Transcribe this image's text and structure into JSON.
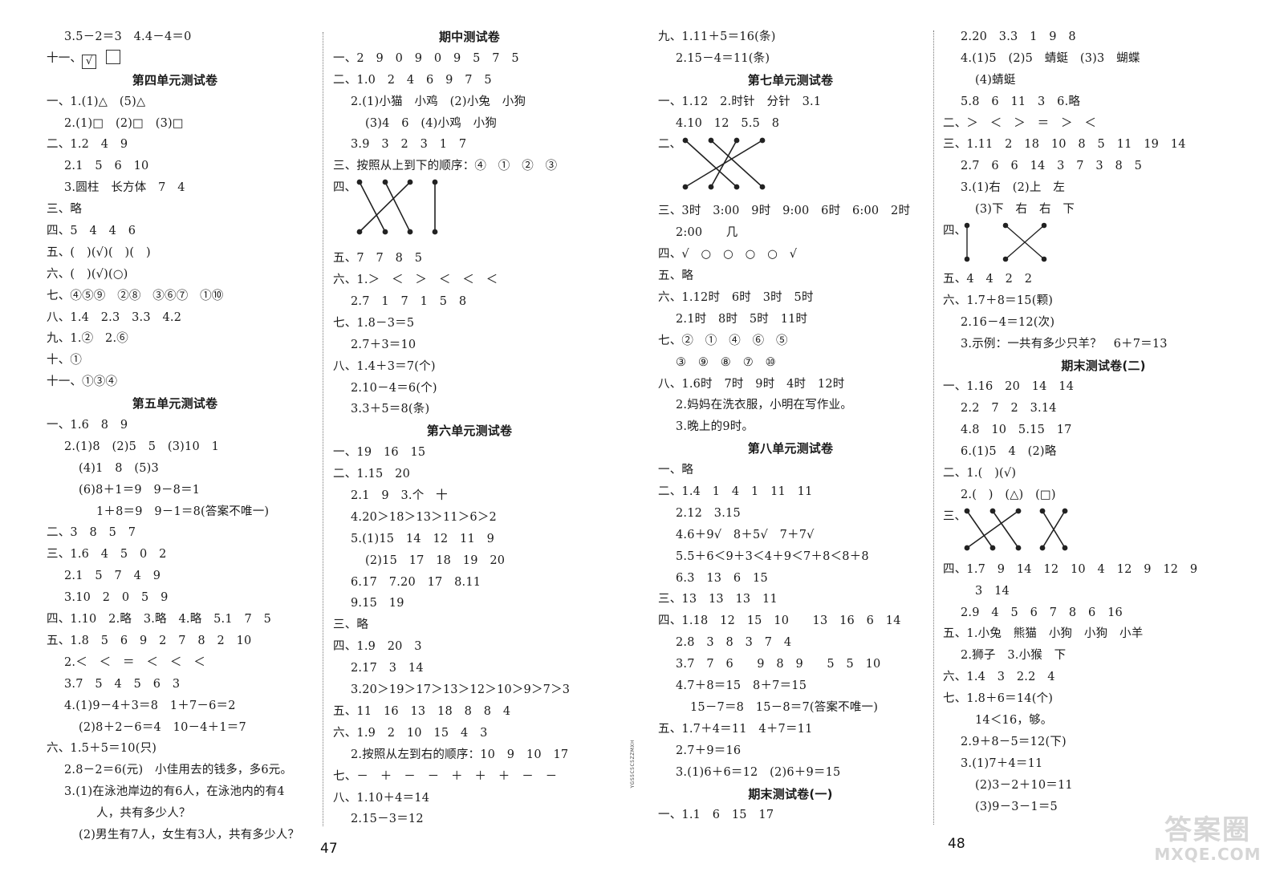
{
  "pages": {
    "left_number": "47",
    "right_number": "48"
  },
  "side_code": "YGS5C5C5ZZMXH",
  "watermark": {
    "line1": "答案圈",
    "line2": "MXQE.COM"
  },
  "col1": {
    "top_line": "3.5－2＝3　4.4－4＝0",
    "eleven_label": "十一、",
    "eleven_box1": "√",
    "eleven_box2": "",
    "unit4_title": "第四单元测试卷",
    "unit4_lines": [
      {
        "t": "一、1.(1)△　(5)△",
        "i": 0
      },
      {
        "t": "2.(1)□　(2)□　(3)□",
        "i": 1
      },
      {
        "t": "二、1.2　4　9",
        "i": 0
      },
      {
        "t": "2.1　5　6　10",
        "i": 1
      },
      {
        "t": "3.圆柱　长方体　7　4",
        "i": 1
      },
      {
        "t": "三、略",
        "i": 0
      },
      {
        "t": "四、5　4　4　6",
        "i": 0
      },
      {
        "t": "五、(　)(√)(　)(　)",
        "i": 0
      },
      {
        "t": "六、(　)(√)(○)",
        "i": 0
      },
      {
        "t": "七、④⑤⑨　②⑧　③⑥⑦　①⑩",
        "i": 0
      },
      {
        "t": "八、1.4　2.3　3.3　4.2",
        "i": 0
      },
      {
        "t": "九、1.②　2.⑥",
        "i": 0
      },
      {
        "t": "十、①",
        "i": 0
      },
      {
        "t": "十一、①③④",
        "i": 0
      }
    ],
    "unit5_title": "第五单元测试卷",
    "unit5_lines": [
      {
        "t": "一、1.6　8　9",
        "i": 0
      },
      {
        "t": "2.(1)8　(2)5　5　(3)10　1",
        "i": 1
      },
      {
        "t": "(4)1　8　(5)3",
        "i": 2
      },
      {
        "t": "(6)8＋1＝9　9－8＝1",
        "i": 2
      },
      {
        "t": "1＋8＝9　9－1＝8(答案不唯一)",
        "i": 3
      },
      {
        "t": "二、3　8　5　7",
        "i": 0
      },
      {
        "t": "三、1.6　4　5　0　2",
        "i": 0
      },
      {
        "t": "2.1　5　7　4　9",
        "i": 1
      },
      {
        "t": "3.10　2　0　5　9",
        "i": 1
      },
      {
        "t": "四、1.10　2.略　3.略　4.略　5.1　7　5",
        "i": 0
      },
      {
        "t": "五、1.8　5　6　9　2　7　8　2　10",
        "i": 0
      },
      {
        "t": "2.＜　＜　＝　＜　＜　＜",
        "i": 1
      },
      {
        "t": "3.7　5　4　5　6　3",
        "i": 1
      },
      {
        "t": "4.(1)9－4＋3＝8　1＋7－6＝2",
        "i": 1
      },
      {
        "t": "(2)8＋2－6＝4　10－4＋1＝7",
        "i": 2
      },
      {
        "t": "六、1.5＋5＝10(只)",
        "i": 0
      },
      {
        "t": "2.8－2＝6(元)　小佳用去的钱多，多6元。",
        "i": 1
      },
      {
        "t": "3.(1)在泳池岸边的有6人，在泳池内的有4",
        "i": 1
      },
      {
        "t": "人，共有多少人？",
        "i": 3
      },
      {
        "t": "(2)男生有7人，女生有3人，共有多少人？",
        "i": 2
      }
    ]
  },
  "col2": {
    "midterm_title": "期中测试卷",
    "midterm_lines_a": [
      {
        "t": "一、2　9　0　9　0　9　5　7　5",
        "i": 0
      },
      {
        "t": "二、1.0　2　4　6　9　7　5",
        "i": 0
      },
      {
        "t": "2.(1)小猫　小鸡　(2)小兔　小狗",
        "i": 1
      },
      {
        "t": "(3)4　6　(4)小鸡　小狗",
        "i": 2
      },
      {
        "t": "3.9　3　2　3　1　7",
        "i": 1
      },
      {
        "t": "三、按照从上到下的顺序：④　①　②　③",
        "i": 0
      }
    ],
    "diagram4_label": "四、",
    "midterm_lines_b": [
      {
        "t": "五、7　7　8　5",
        "i": 0
      },
      {
        "t": "六、1.＞　＜　＞　＜　＜　＜",
        "i": 0
      },
      {
        "t": "2.7　1　7　1　5　8",
        "i": 1
      },
      {
        "t": "七、1.8－3＝5",
        "i": 0
      },
      {
        "t": "2.7＋3＝10",
        "i": 1
      },
      {
        "t": "八、1.4＋3＝7(个)",
        "i": 0
      },
      {
        "t": "2.10－4＝6(个)",
        "i": 1
      },
      {
        "t": "3.3＋5＝8(条)",
        "i": 1
      }
    ],
    "unit6_title": "第六单元测试卷",
    "unit6_lines": [
      {
        "t": "一、19　16　15",
        "i": 0
      },
      {
        "t": "二、1.15　20",
        "i": 0
      },
      {
        "t": "2.1　9　3.个　十",
        "i": 1
      },
      {
        "t": "4.20＞18＞13＞11＞6＞2",
        "i": 1
      },
      {
        "t": "5.(1)15　14　12　11　9",
        "i": 1
      },
      {
        "t": "(2)15　17　18　19　20",
        "i": 2
      },
      {
        "t": "6.17　7.20　17　8.11",
        "i": 1
      },
      {
        "t": "9.15　19",
        "i": 1
      },
      {
        "t": "三、略",
        "i": 0
      },
      {
        "t": "四、1.9　20　3",
        "i": 0
      },
      {
        "t": "2.17　3　14",
        "i": 1
      },
      {
        "t": "3.20＞19＞17＞13＞12＞10＞9＞7＞3",
        "i": 1
      },
      {
        "t": "五、11　16　13　18　8　8　4",
        "i": 0
      },
      {
        "t": "六、1.9　2　10　15　4　3",
        "i": 0
      },
      {
        "t": "2.按照从左到右的顺序：10　9　10　17",
        "i": 1
      },
      {
        "t": "七、－　＋　－　－　＋　＋　＋　－　－",
        "i": 0
      },
      {
        "t": "八、1.10＋4＝14",
        "i": 0
      },
      {
        "t": "2.15－3＝12",
        "i": 1
      }
    ]
  },
  "col3": {
    "top_lines": [
      {
        "t": "九、1.11＋5＝16(条)",
        "i": 0
      },
      {
        "t": "2.15－4＝11(条)",
        "i": 1
      }
    ],
    "unit7_title": "第七单元测试卷",
    "unit7_lines_a": [
      {
        "t": "一、1.12　2.时针　分针　3.1",
        "i": 0
      },
      {
        "t": "4.10　12　5.5　8",
        "i": 1
      }
    ],
    "diagram2_label": "二、",
    "unit7_lines_b": [
      {
        "t": "三、3时　3:00　9时　9:00　6时　6:00　2时",
        "i": 0
      },
      {
        "t": "2:00　　几",
        "i": 1
      },
      {
        "t": "四、√　○　○　○　○　√",
        "i": 0
      },
      {
        "t": "五、略",
        "i": 0
      },
      {
        "t": "六、1.12时　6时　3时　5时",
        "i": 0
      },
      {
        "t": "2.1时　8时　5时　11时",
        "i": 1
      },
      {
        "t": "七、②　①　④　⑥　⑤",
        "i": 0
      },
      {
        "t": "③　⑨　⑧　⑦　⑩",
        "i": 1
      },
      {
        "t": "八、1.6时　7时　9时　4时　12时",
        "i": 0
      },
      {
        "t": "2.妈妈在洗衣服，小明在写作业。",
        "i": 1
      },
      {
        "t": "3.晚上的9时。",
        "i": 1
      }
    ],
    "unit8_title": "第八单元测试卷",
    "unit8_lines": [
      {
        "t": "一、略",
        "i": 0
      },
      {
        "t": "二、1.4　1　4　1　11　11",
        "i": 0
      },
      {
        "t": "2.12　3.15",
        "i": 1
      },
      {
        "t": "4.6＋9√　8＋5√　7＋7√",
        "i": 1
      },
      {
        "t": "5.5＋6＜9＋3＜4＋9＜7＋8＜8＋8",
        "i": 1
      },
      {
        "t": "6.3　13　6　15",
        "i": 1
      },
      {
        "t": "三、13　13　13　11",
        "i": 0
      },
      {
        "t": "四、1.18　12　15　10　　13　16　6　14",
        "i": 0
      },
      {
        "t": "2.8　3　8　3　7　4",
        "i": 1
      },
      {
        "t": "3.7　7　6　　9　8　9　　5　5　10",
        "i": 1
      },
      {
        "t": "4.7＋8＝15　8＋7＝15",
        "i": 1
      },
      {
        "t": "15－7＝8　15－8＝7(答案不唯一)",
        "i": 2
      },
      {
        "t": "五、1.7＋4＝11　4＋7＝11",
        "i": 0
      },
      {
        "t": "2.7＋9＝16",
        "i": 1
      },
      {
        "t": "3.(1)6＋6＝12　(2)6＋9＝15",
        "i": 1
      }
    ],
    "final1_title": "期末测试卷(一)",
    "final1_lines": [
      {
        "t": "一、1.1　6　15　17",
        "i": 0
      }
    ]
  },
  "col4": {
    "top_lines": [
      {
        "t": "2.20　3.3　1　9　8",
        "i": 1
      },
      {
        "t": "4.(1)5　(2)5　蜻蜓　(3)3　蝴蝶",
        "i": 1
      },
      {
        "t": "(4)蜻蜓",
        "i": 2
      },
      {
        "t": "5.8　6　11　3　6.略",
        "i": 1
      },
      {
        "t": "二、＞　＜　＞　＝　＞　＜",
        "i": 0
      },
      {
        "t": "三、1.11　2　18　10　8　5　11　19　14",
        "i": 0
      },
      {
        "t": "2.7　6　6　14　3　7　3　8　5",
        "i": 1
      },
      {
        "t": "3.(1)右　(2)上　左",
        "i": 1
      },
      {
        "t": "(3)下　右　右　下",
        "i": 2
      }
    ],
    "diagram4_label": "四、",
    "mid_lines": [
      {
        "t": "五、4　4　2　2",
        "i": 0
      },
      {
        "t": "六、1.7＋8＝15(颗)",
        "i": 0
      },
      {
        "t": "2.16－4＝12(次)",
        "i": 1
      },
      {
        "t": "3.示例：一共有多少只羊？　6＋7＝13",
        "i": 1
      }
    ],
    "final2_title": "期末测试卷(二)",
    "final2_lines_a": [
      {
        "t": "一、1.16　20　14　14",
        "i": 0
      },
      {
        "t": "2.2　7　2　3.14",
        "i": 1
      },
      {
        "t": "4.8　10　5.15　17",
        "i": 1
      },
      {
        "t": "6.(1)5　4　(2)略",
        "i": 1
      },
      {
        "t": "二、1.(　)(√)",
        "i": 0
      },
      {
        "t": "2.(　)　(△)　(□)",
        "i": 1
      }
    ],
    "diagram3_label": "三、",
    "final2_lines_b": [
      {
        "t": "四、1.7　9　14　12　10　4　12　9　12　9",
        "i": 0
      },
      {
        "t": "3　14",
        "i": 2
      },
      {
        "t": "2.9　4　5　6　7　8　6　16",
        "i": 1
      },
      {
        "t": "五、1.小兔　熊猫　小狗　小狗　小羊",
        "i": 0
      },
      {
        "t": "2.狮子　3.小猴　下",
        "i": 1
      },
      {
        "t": "六、1.4　3　2.2　4",
        "i": 0
      },
      {
        "t": "七、1.8＋6＝14(个)",
        "i": 0
      },
      {
        "t": "14＜16，够。",
        "i": 2
      },
      {
        "t": "2.9＋8－5＝12(下)",
        "i": 1
      },
      {
        "t": "3.(1)7＋4＝11",
        "i": 1
      },
      {
        "t": "(2)3－2＋10＝11",
        "i": 2
      },
      {
        "t": "(3)9－3－1＝5",
        "i": 2
      }
    ]
  }
}
